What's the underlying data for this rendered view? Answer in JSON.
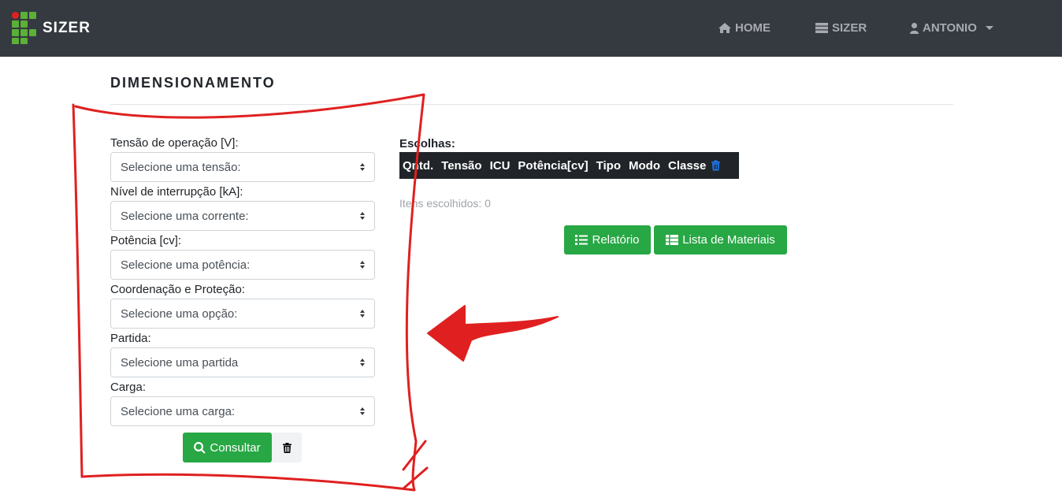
{
  "navbar": {
    "brand": "SIZER",
    "items": [
      {
        "label": "HOME",
        "icon": "home-icon"
      },
      {
        "label": "SIZER",
        "icon": "server-icon"
      },
      {
        "label": "ANTONIO",
        "icon": "user-icon"
      }
    ]
  },
  "page": {
    "title": "DIMENSIONAMENTO"
  },
  "form": {
    "fields": [
      {
        "label": "Tensão de operação [V]:",
        "selected": "Selecione uma tensão:"
      },
      {
        "label": "Nível de interrupção [kA]:",
        "selected": "Selecione uma corrente:"
      },
      {
        "label": "Potência [cv]:",
        "selected": "Selecione uma potência:"
      },
      {
        "label": "Coordenação e Proteção:",
        "selected": "Selecione uma opção:"
      },
      {
        "label": "Partida:",
        "selected": "Selecione uma partida"
      },
      {
        "label": "Carga:",
        "selected": "Selecione uma carga:"
      }
    ],
    "consultar_label": "Consultar"
  },
  "escolhas": {
    "label": "Escolhas:",
    "columns": [
      "Qntd.",
      "Tensão",
      "ICU",
      "Potência[cv]",
      "Tipo",
      "Modo",
      "Classe"
    ],
    "itens_text": "Itens escolhidos: 0",
    "relatorio_label": "Relatório",
    "lista_label": "Lista de Materiais"
  },
  "colors": {
    "navbar": "#343a40",
    "success": "#28a745",
    "annotation": "#e02020",
    "logo_green": "#5cb037",
    "logo_red": "#e02020"
  }
}
